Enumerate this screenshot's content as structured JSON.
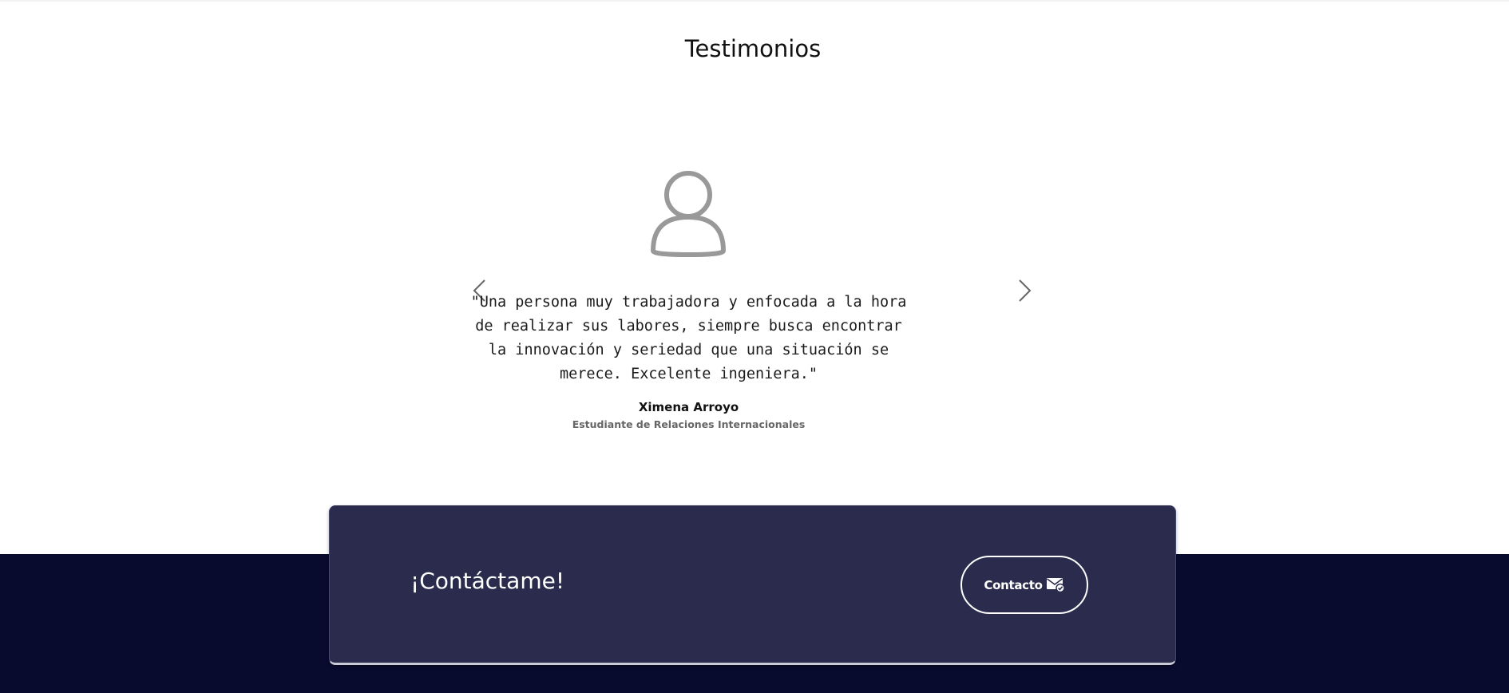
{
  "testimonials": {
    "title": "Testimonios",
    "current": {
      "quote": "\"Una persona muy trabajadora y enfocada a la hora de realizar sus labores, siempre busca encontrar la innovación y seriedad que una situación se merece. Excelente ingeniera.\"",
      "author_name": "Ximena Arroyo",
      "author_role": "Estudiante de Relaciones Internacionales",
      "avatar_icon": "user-icon"
    },
    "prev_icon": "chevron-left-icon",
    "next_icon": "chevron-right-icon"
  },
  "contact": {
    "title": "¡Contáctame!",
    "button_label": "Contacto",
    "button_icon": "mail-check-icon"
  },
  "colors": {
    "footer_background": "#080b2e",
    "card_background": "#2b2c4d",
    "avatar_gray": "#999999"
  }
}
